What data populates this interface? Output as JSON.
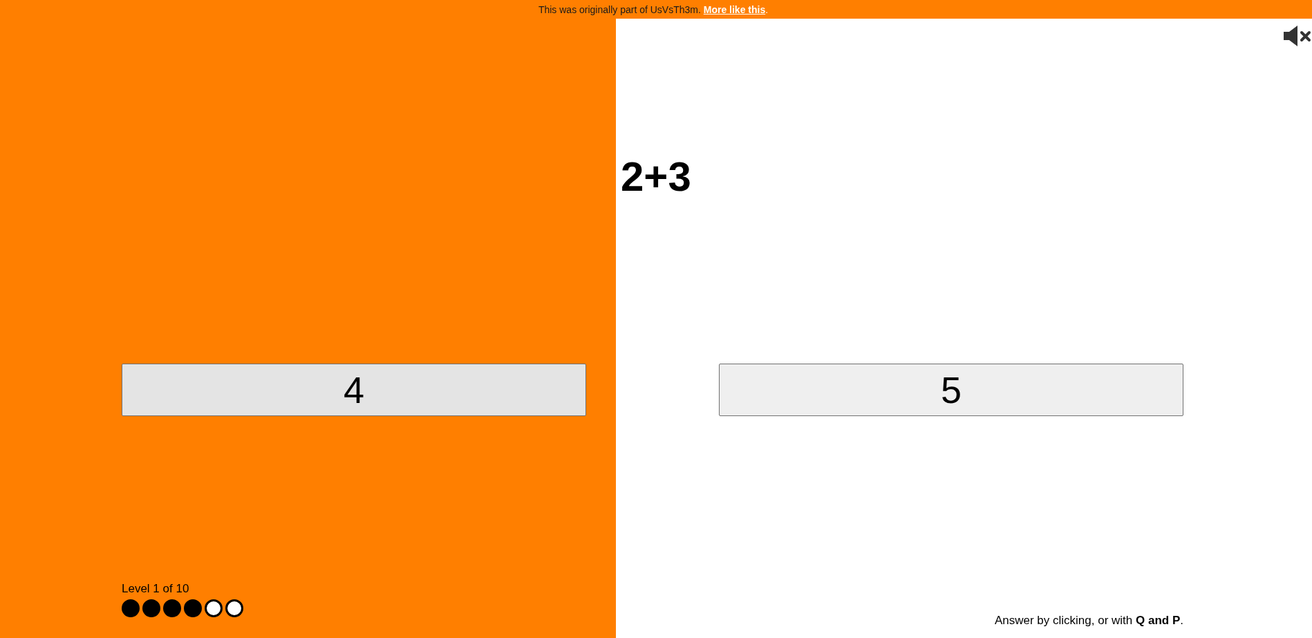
{
  "banner": {
    "text": "This was originally part of UsVsTh3m.",
    "link": "More like this",
    "after": "."
  },
  "sound": {
    "muted": true
  },
  "problem": "2+3",
  "answers": [
    {
      "label": "4"
    },
    {
      "label": "5"
    }
  ],
  "level": {
    "text": "Level 1 of 10",
    "dots": [
      {
        "filled": true
      },
      {
        "filled": true
      },
      {
        "filled": true
      },
      {
        "filled": true
      },
      {
        "filled": false
      },
      {
        "filled": false
      }
    ]
  },
  "hint": "Answer by clicking, or with **Q and P**."
}
